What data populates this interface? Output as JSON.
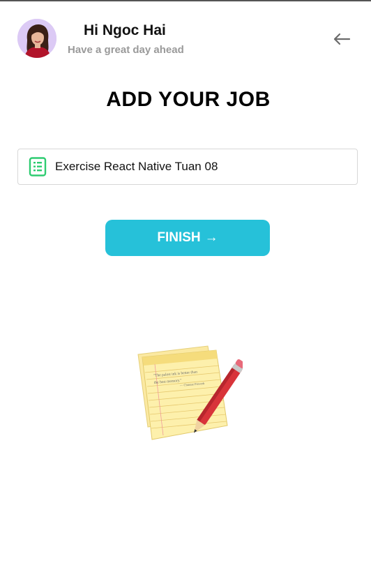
{
  "header": {
    "greeting": "Hi Ngoc Hai",
    "subtitle": "Have a great day ahead",
    "avatar_icon": "user-avatar",
    "back_icon": "arrow-left-icon"
  },
  "page": {
    "title": "ADD YOUR JOB"
  },
  "job_input": {
    "value": "Exercise React Native Tuan 08",
    "icon": "document-icon",
    "icon_color": "#2ecc71"
  },
  "finish_button": {
    "label": "FINISH",
    "arrow": "→",
    "color": "#26c1d9"
  },
  "illustration": {
    "icon": "notepad-pencil-icon",
    "note_text_1": "\"The palest ink is better than",
    "note_text_2": "the best memory.\"",
    "note_author": "— Chinese Proverb"
  }
}
